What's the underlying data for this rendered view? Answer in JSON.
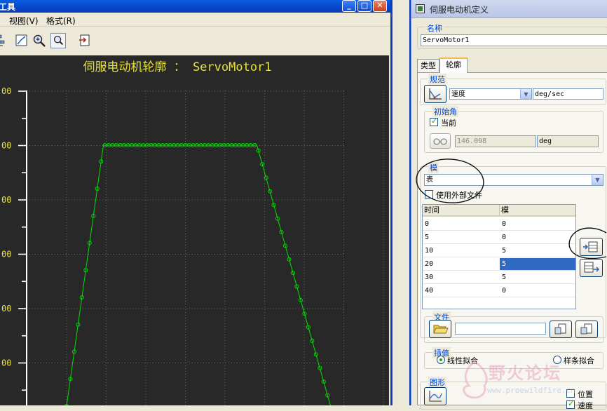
{
  "left_window": {
    "title": "工具",
    "menu": [
      "视图(V)",
      "格式(R)"
    ],
    "graph_title": "伺服电动机轮廓 ： ServoMotor1",
    "y_tick_labels": [
      "00",
      "00",
      "00",
      "00",
      "00",
      "00"
    ]
  },
  "chart_data": {
    "type": "line",
    "title": "伺服电动机轮廓 ： ServoMotor1",
    "series": [
      {
        "x": [
          0,
          5,
          10,
          20,
          30,
          40
        ],
        "y": [
          0,
          0,
          5,
          5,
          5,
          0
        ]
      }
    ],
    "grid": true,
    "color": "#00e000"
  },
  "dialog": {
    "title": "伺服电动机定义",
    "name_label": "名称",
    "name_value": "ServoMotor1",
    "tabs": [
      "类型",
      "轮廓"
    ],
    "spec_label": "规范",
    "spec_select": "速度",
    "spec_unit": "deg/sec",
    "initial_angle_label": "初始角",
    "current_label": "当前",
    "angle_value": "146.098",
    "angle_unit": "deg",
    "magnitude_label": "模",
    "magnitude_select": "表",
    "use_external_file": "使用外部文件",
    "table": {
      "columns": [
        "时间",
        "模"
      ],
      "rows": [
        [
          "0",
          "0"
        ],
        [
          "5",
          "0"
        ],
        [
          "10",
          "5"
        ],
        [
          "20",
          "5"
        ],
        [
          "30",
          "5"
        ],
        [
          "40",
          "0"
        ]
      ],
      "selected_row": 3
    },
    "file_label": "文件",
    "interp_label": "插值",
    "linear_fit": "线性拟合",
    "spline_fit": "样条拟合",
    "graph_label": "图形",
    "position_label": "位置",
    "velocity_label": "速度"
  },
  "watermark": {
    "text": "野火论坛",
    "url": "www.proewildfire.cn"
  }
}
